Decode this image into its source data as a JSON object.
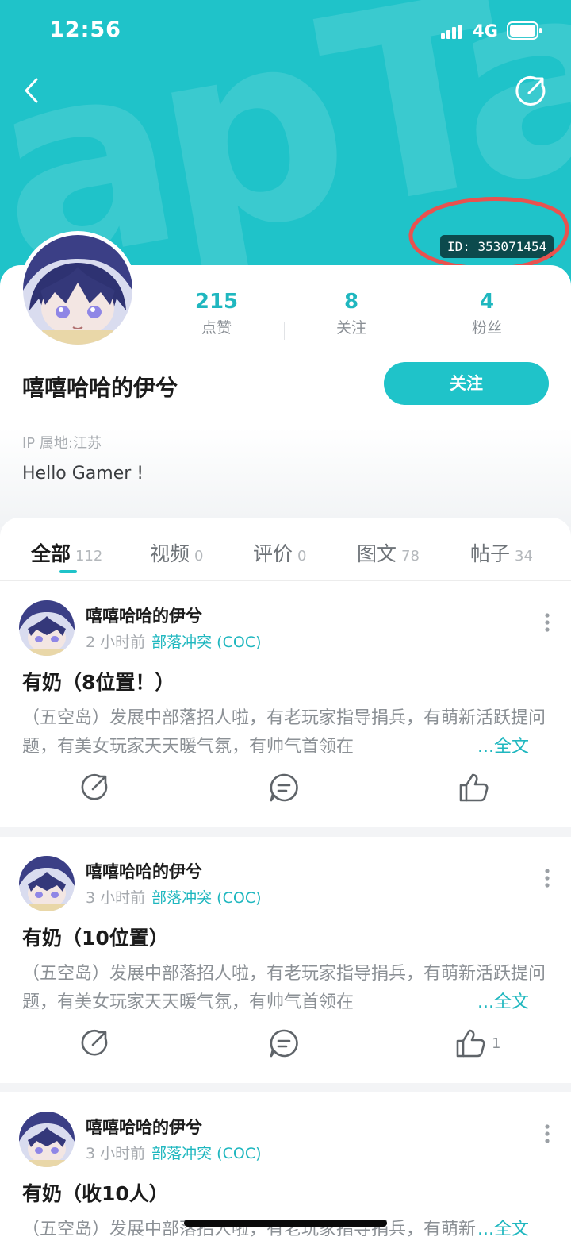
{
  "status_bar": {
    "time": "12:56",
    "network": "4G"
  },
  "header": {
    "watermark": "apTap",
    "user_id": "ID: 353071454"
  },
  "profile": {
    "stats": [
      {
        "value": "215",
        "label": "点赞"
      },
      {
        "value": "8",
        "label": "关注"
      },
      {
        "value": "4",
        "label": "粉丝"
      }
    ],
    "username": "嘻嘻哈哈的伊兮",
    "follow_label": "关注",
    "ip_location": "IP 属地:江苏",
    "bio": "Hello Gamer !"
  },
  "tabs": [
    {
      "label": "全部",
      "count": "112",
      "active": true
    },
    {
      "label": "视频",
      "count": "0"
    },
    {
      "label": "评价",
      "count": "0"
    },
    {
      "label": "图文",
      "count": "78"
    },
    {
      "label": "帖子",
      "count": "34"
    }
  ],
  "posts": [
    {
      "author": "嘻嘻哈哈的伊兮",
      "time": "2 小时前",
      "forum": "部落冲突 (COC)",
      "title": "有奶（8位置！）",
      "body": "（五空岛）发展中部落招人啦，有老玩家指导捐兵，有萌新活跃提问题，有美女玩家天天暖气氛，有帅气首领在",
      "more": "...全文",
      "likes": ""
    },
    {
      "author": "嘻嘻哈哈的伊兮",
      "time": "3 小时前",
      "forum": "部落冲突 (COC)",
      "title": "有奶（10位置）",
      "body": "（五空岛）发展中部落招人啦，有老玩家指导捐兵，有萌新活跃提问题，有美女玩家天天暖气氛，有帅气首领在",
      "more": "...全文",
      "likes": "1"
    },
    {
      "author": "嘻嘻哈哈的伊兮",
      "time": "3 小时前",
      "forum": "部落冲突 (COC)",
      "title": "有奶（收10人）",
      "body": "（五空岛）发展中部落招人啦，有老玩家指导捐兵，有萌新活跃提问题，有美女玩家天天暖气氛，有帅气首领在",
      "more": "...全文",
      "likes": ""
    }
  ],
  "colors": {
    "brand": "#1fc3c9",
    "accent_text": "#1fb7bf",
    "annotation": "#e8524f"
  }
}
